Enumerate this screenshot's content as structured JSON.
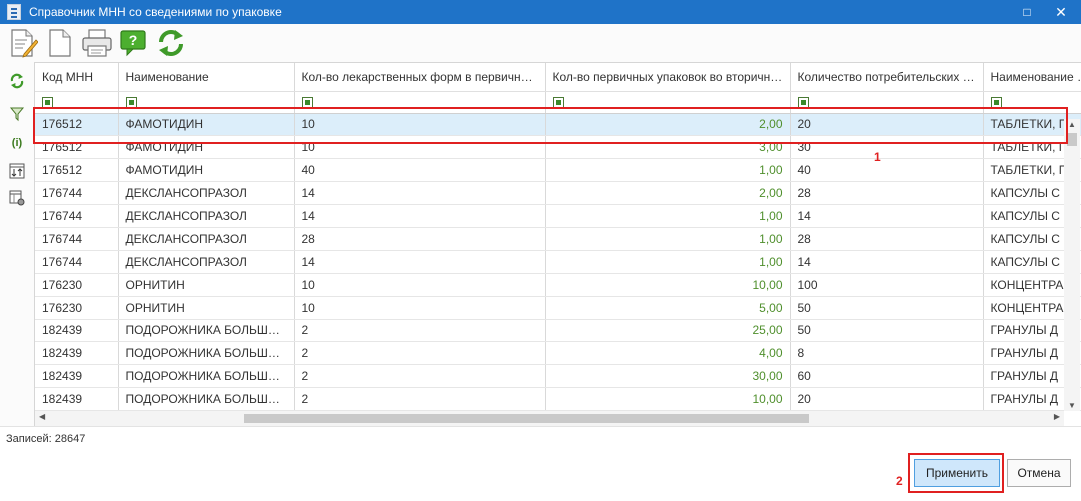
{
  "window": {
    "title": "Справочник МНН со сведениями по упаковке",
    "controls": [
      "□",
      "✕"
    ]
  },
  "toolbar": {
    "icons": [
      "edit-document-icon",
      "blank-document-icon",
      "printer-icon",
      "help-icon",
      "refresh-icon"
    ],
    "help_glyph": "?"
  },
  "leftbar": {
    "icons": [
      "refresh-icon",
      "filter-icon",
      "info-icon",
      "sort-icon",
      "column-settings-icon"
    ],
    "info_glyph": "(i)"
  },
  "grid": {
    "columns": [
      "Код МНН",
      "Наименование",
      "Кол-во лекарственных форм в первичной упаковке",
      "Кол-во первичных упаковок во вторичной упаковке",
      "Количество потребительских единиц",
      "Наименование лекарственной формы"
    ],
    "rows": [
      [
        "176512",
        "ФАМОТИДИН",
        "10",
        "2,00",
        "20",
        "ТАБЛЕТКИ, П"
      ],
      [
        "176512",
        "ФАМОТИДИН",
        "10",
        "3,00",
        "30",
        "ТАБЛЕТКИ, П"
      ],
      [
        "176512",
        "ФАМОТИДИН",
        "40",
        "1,00",
        "40",
        "ТАБЛЕТКИ, П"
      ],
      [
        "176744",
        "ДЕКСЛАНСОПРАЗОЛ",
        "14",
        "2,00",
        "28",
        "КАПСУЛЫ С"
      ],
      [
        "176744",
        "ДЕКСЛАНСОПРАЗОЛ",
        "14",
        "1,00",
        "14",
        "КАПСУЛЫ С"
      ],
      [
        "176744",
        "ДЕКСЛАНСОПРАЗОЛ",
        "28",
        "1,00",
        "28",
        "КАПСУЛЫ С"
      ],
      [
        "176744",
        "ДЕКСЛАНСОПРАЗОЛ",
        "14",
        "1,00",
        "14",
        "КАПСУЛЫ С"
      ],
      [
        "176230",
        "ОРНИТИН",
        "10",
        "10,00",
        "100",
        "КОНЦЕНТРА"
      ],
      [
        "176230",
        "ОРНИТИН",
        "10",
        "5,00",
        "50",
        "КОНЦЕНТРА"
      ],
      [
        "182439",
        "ПОДОРОЖНИКА БОЛЬШОГО",
        "2",
        "25,00",
        "50",
        "ГРАНУЛЫ Д"
      ],
      [
        "182439",
        "ПОДОРОЖНИКА БОЛЬШОГО",
        "2",
        "4,00",
        "8",
        "ГРАНУЛЫ Д"
      ],
      [
        "182439",
        "ПОДОРОЖНИКА БОЛЬШОГО",
        "2",
        "30,00",
        "60",
        "ГРАНУЛЫ Д"
      ],
      [
        "182439",
        "ПОДОРОЖНИКА БОЛЬШОГО",
        "2",
        "10,00",
        "20",
        "ГРАНУЛЫ Д"
      ]
    ],
    "selected_row": 0
  },
  "status": {
    "records": "Записей: 28647"
  },
  "footer": {
    "apply_label": "Применить",
    "cancel_label": "Отмена"
  },
  "annotations": {
    "mark1": "1",
    "mark2": "2"
  },
  "colors": {
    "titlebar": "#1f73c8",
    "numeric_text": "#4f8f2c",
    "selection": "#dceefa",
    "annotation": "#e02020"
  }
}
